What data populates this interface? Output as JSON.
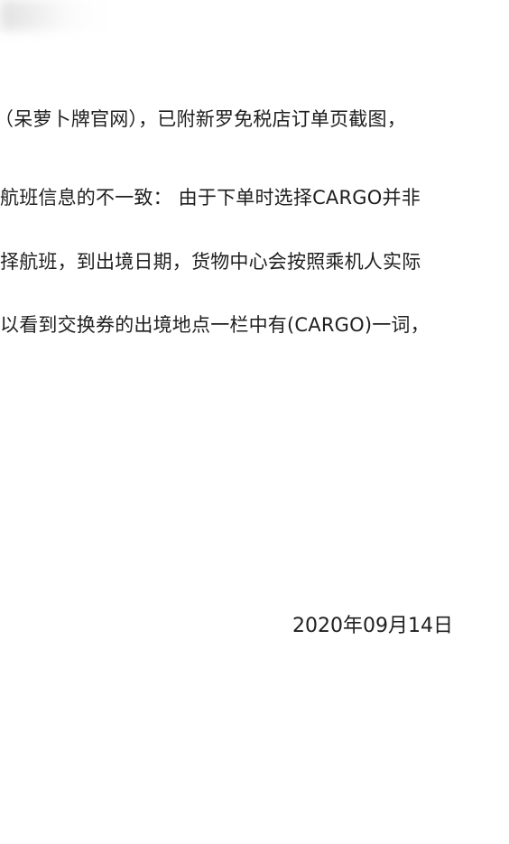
{
  "document": {
    "lines": [
      "（呆萝卜牌官网），已附新罗免税店订单页截图，",
      "航班信息的不一致： 由于下单时选择CARGO并非",
      "择航班，到出境日期，货物中心会按照乘机人实际",
      "以看到交换券的出境地点一栏中有(CARGO)一词，"
    ],
    "date": "2020年09月14日"
  }
}
